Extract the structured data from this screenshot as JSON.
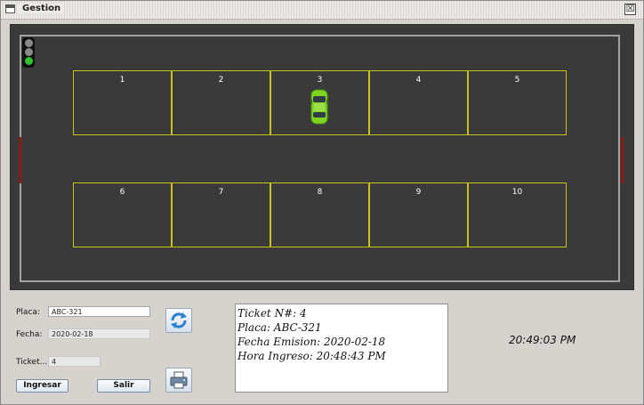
{
  "window": {
    "title": "Gestion",
    "close_symbol": "☒"
  },
  "lot": {
    "traffic_light": {
      "active": "green"
    },
    "spots": [
      "1",
      "2",
      "3",
      "4",
      "5",
      "6",
      "7",
      "8",
      "9",
      "10"
    ],
    "occupied_spot": "3"
  },
  "form": {
    "placa_label": "Placa:",
    "placa_value": "ABC-321",
    "fecha_label": "Fecha:",
    "fecha_value": "2020-02-18",
    "ticket_label": "Ticket...",
    "ticket_value": "4",
    "ingresar_label": "Ingresar",
    "salir_label": "Salir",
    "refresh_icon": "refresh-icon",
    "print_icon": "printer-icon"
  },
  "ticket": {
    "line1": "Ticket N#: 4",
    "line2": "Placa: ABC-321",
    "line3": "Fecha Emision: 2020-02-18",
    "line4": "Hora Ingreso: 20:48:43 PM"
  },
  "clock": "20:49:03 PM",
  "colors": {
    "lot": "#3a3a3a",
    "spot_line": "#c8c21c",
    "car": "#7ed321",
    "light_on": "#2ec32e",
    "gate": "#8b1a1a"
  }
}
